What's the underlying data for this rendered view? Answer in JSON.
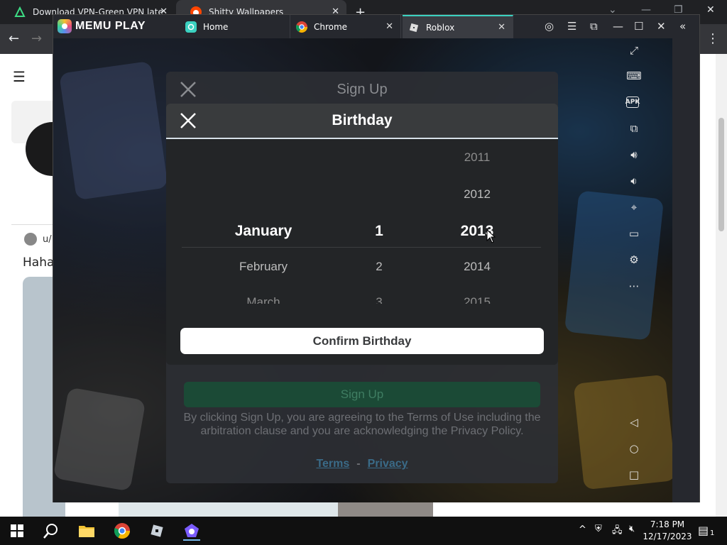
{
  "chrome": {
    "tabs": [
      {
        "title": "Download VPN-Green VPN late",
        "icon": "android-icon"
      },
      {
        "title": "Shitty Wallpapers",
        "icon": "reddit-icon"
      }
    ],
    "new_tab": "+"
  },
  "reddit": {
    "user_prefix": "u/",
    "post_snippet": "Haha"
  },
  "memu": {
    "brand": "MEMU PLAY",
    "tabs": [
      {
        "label": "Home",
        "icon": "memu-home-icon"
      },
      {
        "label": "Chrome",
        "icon": "chrome-icon"
      },
      {
        "label": "Roblox",
        "icon": "roblox-icon"
      }
    ]
  },
  "signup": {
    "title": "Sign Up",
    "button": "Sign Up",
    "legal_text": "By clicking Sign Up, you are agreeing to the Terms of Use including the arbitration clause and you are acknowledging the Privacy Policy.",
    "terms_link": "Terms",
    "separator": "-",
    "privacy_link": "Privacy"
  },
  "birthday": {
    "title": "Birthday",
    "months": {
      "selected": "January",
      "next": "February",
      "next2": "March"
    },
    "days": {
      "selected": "1",
      "next": "2",
      "next2": "3"
    },
    "years": {
      "prev2": "2011",
      "prev": "2012",
      "selected": "2013",
      "next": "2014",
      "next2": "2015"
    },
    "confirm": "Confirm Birthday"
  },
  "taskbar": {
    "time": "7:18 PM",
    "date": "12/17/2023",
    "notification_count": "1"
  },
  "colors": {
    "accent": "#3bd1c0",
    "signup_green": "#1b4a36",
    "link_blue": "#3a6b88"
  }
}
